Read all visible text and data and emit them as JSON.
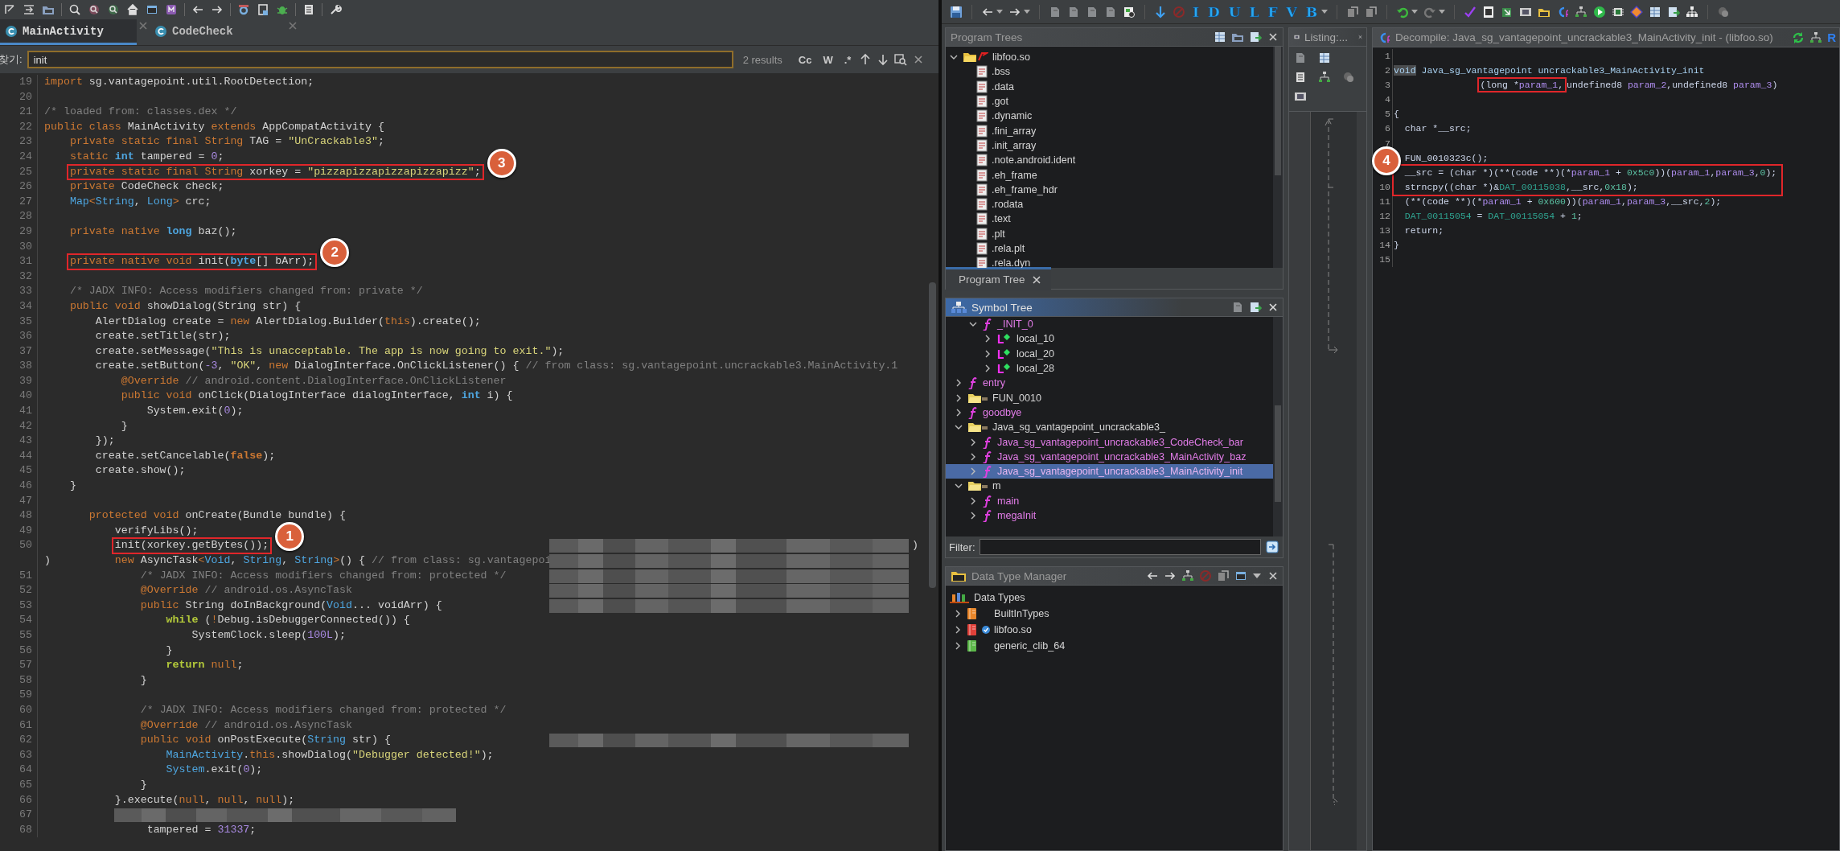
{
  "jadx": {
    "tabs": [
      {
        "label": "MainActivity",
        "selected": true
      },
      {
        "label": "CodeCheck",
        "selected": false
      }
    ],
    "search": {
      "label": "찾기:",
      "value": "init",
      "result_count": "2 results",
      "options": [
        "Cc",
        "W",
        ".*"
      ]
    },
    "code": [
      {
        "num": "19",
        "kind": "code",
        "segs": [
          {
            "kind": "kw",
            "text": "import"
          },
          {
            "kind": "pl",
            "text": " sg.vantagepoint.util.RootDetection;"
          }
        ]
      },
      {
        "num": "20",
        "kind": "blank"
      },
      {
        "num": "21",
        "kind": "code",
        "segs": [
          {
            "kind": "cm",
            "text": "/* loaded from: classes.dex */"
          }
        ]
      },
      {
        "num": "22",
        "kind": "code",
        "segs": [
          {
            "kind": "kw",
            "text": "public class"
          },
          {
            "kind": "pl",
            "text": " MainActivity "
          },
          {
            "kind": "kw",
            "text": "extends"
          },
          {
            "kind": "pl",
            "text": " AppCompatActivity {"
          }
        ]
      },
      {
        "num": "23",
        "kind": "code",
        "segs": [
          {
            "kind": "kw",
            "text": "    private static final String"
          },
          {
            "kind": "pl",
            "text": " TAG = "
          },
          {
            "kind": "str",
            "text": "\"UnCrackable3\""
          },
          {
            "kind": "pl",
            "text": ";"
          }
        ]
      },
      {
        "num": "24",
        "kind": "code",
        "segs": [
          {
            "kind": "kw",
            "text": "    static "
          },
          {
            "kind": "pt",
            "text": "int"
          },
          {
            "kind": "pl",
            "text": " tampered = "
          },
          {
            "kind": "num",
            "text": "0"
          },
          {
            "kind": "pl",
            "text": ";"
          }
        ]
      },
      {
        "num": "25",
        "kind": "boxed",
        "badge": "3",
        "segs": [
          {
            "kind": "kw",
            "text": "    private static final String"
          },
          {
            "kind": "pl",
            "text": " xorkey = "
          },
          {
            "kind": "str",
            "text": "\"pizzapizzapizzapizzapizz\""
          },
          {
            "kind": "pl",
            "text": ";"
          }
        ]
      },
      {
        "num": "26",
        "kind": "code",
        "segs": [
          {
            "kind": "kw",
            "text": "    private"
          },
          {
            "kind": "pl",
            "text": " CodeCheck check;"
          }
        ]
      },
      {
        "num": "27",
        "kind": "code",
        "segs": [
          {
            "kind": "ty",
            "text": "    Map"
          },
          {
            "kind": "kw",
            "text": "<"
          },
          {
            "kind": "ty",
            "text": "String"
          },
          {
            "kind": "pl",
            "text": ", "
          },
          {
            "kind": "ty",
            "text": "Long"
          },
          {
            "kind": "kw",
            "text": ">"
          },
          {
            "kind": "pl",
            "text": " crc;"
          }
        ]
      },
      {
        "num": "28",
        "kind": "blank"
      },
      {
        "num": "29",
        "kind": "code",
        "segs": [
          {
            "kind": "kw",
            "text": "    private native "
          },
          {
            "kind": "pt",
            "text": "long"
          },
          {
            "kind": "pl",
            "text": " baz();"
          }
        ]
      },
      {
        "num": "30",
        "kind": "blank"
      },
      {
        "num": "31",
        "kind": "boxed",
        "badge": "2",
        "segs": [
          {
            "kind": "kw",
            "text": "    private native void"
          },
          {
            "kind": "pl",
            "text": " init("
          },
          {
            "kind": "pt",
            "text": "byte"
          },
          {
            "kind": "pl",
            "text": "[] bArr);"
          }
        ]
      },
      {
        "num": "32",
        "kind": "blank"
      },
      {
        "num": "33",
        "kind": "code",
        "segs": [
          {
            "kind": "cm",
            "text": "    /* JADX INFO: Access modifiers changed from: private */"
          }
        ]
      },
      {
        "num": "34",
        "kind": "code",
        "segs": [
          {
            "kind": "kw",
            "text": "    public void"
          },
          {
            "kind": "pl",
            "text": " showDialog(String str) {"
          }
        ]
      },
      {
        "num": "35",
        "kind": "code",
        "segs": [
          {
            "kind": "pl",
            "text": "        AlertDialog create = "
          },
          {
            "kind": "kw",
            "text": "new"
          },
          {
            "kind": "pl",
            "text": " AlertDialog.Builder("
          },
          {
            "kind": "kw",
            "text": "this"
          },
          {
            "kind": "pl",
            "text": ").create();"
          }
        ]
      },
      {
        "num": "36",
        "kind": "code",
        "segs": [
          {
            "kind": "pl",
            "text": "        create.setTitle(str);"
          }
        ]
      },
      {
        "num": "37",
        "kind": "code",
        "segs": [
          {
            "kind": "pl",
            "text": "        create.setMessage("
          },
          {
            "kind": "str",
            "text": "\"This is unacceptable. The app is now going to exit.\""
          },
          {
            "kind": "pl",
            "text": ");"
          }
        ]
      },
      {
        "num": "38",
        "kind": "code",
        "segs": [
          {
            "kind": "pl",
            "text": "        create.setButton("
          },
          {
            "kind": "num",
            "text": "-3"
          },
          {
            "kind": "pl",
            "text": ", "
          },
          {
            "kind": "str",
            "text": "\"OK\""
          },
          {
            "kind": "pl",
            "text": ", "
          },
          {
            "kind": "kw",
            "text": "new"
          },
          {
            "kind": "pl",
            "text": " DialogInterface.OnClickListener() { "
          },
          {
            "kind": "cm",
            "text": "// from class: sg.vantagepoint.uncrackable3.MainActivity.1"
          }
        ]
      },
      {
        "num": "39",
        "kind": "code",
        "segs": [
          {
            "kind": "kw",
            "text": "            @Override"
          },
          {
            "kind": "cm",
            "text": " // android.content.DialogInterface.OnClickListener"
          }
        ]
      },
      {
        "num": "40",
        "kind": "code",
        "segs": [
          {
            "kind": "kw",
            "text": "            public void"
          },
          {
            "kind": "pl",
            "text": " onClick(DialogInterface dialogInterface, "
          },
          {
            "kind": "pt",
            "text": "int"
          },
          {
            "kind": "pl",
            "text": " i) {"
          }
        ]
      },
      {
        "num": "41",
        "kind": "code",
        "segs": [
          {
            "kind": "pl",
            "text": "                System.exit("
          },
          {
            "kind": "num",
            "text": "0"
          },
          {
            "kind": "pl",
            "text": ");"
          }
        ]
      },
      {
        "num": "42",
        "kind": "code",
        "segs": [
          {
            "kind": "pl",
            "text": "            }"
          }
        ]
      },
      {
        "num": "43",
        "kind": "code",
        "segs": [
          {
            "kind": "pl",
            "text": "        });"
          }
        ]
      },
      {
        "num": "44",
        "kind": "code",
        "segs": [
          {
            "kind": "pl",
            "text": "        create.setCancelable("
          },
          {
            "kind": "kb",
            "text": "false"
          },
          {
            "kind": "pl",
            "text": ");"
          }
        ]
      },
      {
        "num": "45",
        "kind": "code",
        "segs": [
          {
            "kind": "pl",
            "text": "        create.show();"
          }
        ]
      },
      {
        "num": "46",
        "kind": "code",
        "segs": [
          {
            "kind": "pl",
            "text": "    }"
          }
        ]
      },
      {
        "num": "47",
        "kind": "blank"
      },
      {
        "num": "48",
        "kind": "code",
        "segs": [
          {
            "kind": "kw",
            "text": "       protected void"
          },
          {
            "kind": "pl",
            "text": " onCreate(Bundle bundle) {"
          }
        ]
      },
      {
        "num": "49",
        "kind": "code",
        "segs": [
          {
            "kind": "pl",
            "text": "           verifyLibs();"
          }
        ]
      },
      {
        "num": "50",
        "kind": "boxed",
        "badge": "1",
        "redaction": {
          "kind": "right"
        },
        "tail": ")",
        "segs": [
          {
            "kind": "pl",
            "text": "           init(xorkey.getBytes());"
          }
        ]
      },
      {
        "kind": "code",
        "redaction": {
          "kind": "right"
        },
        "segs": [
          {
            "kind": "pl",
            "text": ")          "
          },
          {
            "kind": "kw",
            "text": "new"
          },
          {
            "kind": "pl",
            "text": " AsyncTask"
          },
          {
            "kind": "kw",
            "text": "<"
          },
          {
            "kind": "ty",
            "text": "Void"
          },
          {
            "kind": "pl",
            "text": ", "
          },
          {
            "kind": "ty",
            "text": "String"
          },
          {
            "kind": "pl",
            "text": ", "
          },
          {
            "kind": "ty",
            "text": "String"
          },
          {
            "kind": "kw",
            "text": ">"
          },
          {
            "kind": "pl",
            "text": "() { "
          },
          {
            "kind": "cm",
            "text": "// from class: sg.vantagepoi"
          }
        ]
      },
      {
        "num": "51",
        "kind": "code",
        "redaction": {
          "kind": "right"
        },
        "segs": [
          {
            "kind": "cm",
            "text": "               /* JADX INFO: Access modifiers changed from: protected */"
          }
        ]
      },
      {
        "num": "52",
        "kind": "code",
        "redaction": {
          "kind": "right"
        },
        "segs": [
          {
            "kind": "kw",
            "text": "               @Override"
          },
          {
            "kind": "cm",
            "text": " // android.os.AsyncTask"
          }
        ]
      },
      {
        "num": "53",
        "kind": "code",
        "redaction": {
          "kind": "right"
        },
        "segs": [
          {
            "kind": "kw",
            "text": "               public"
          },
          {
            "kind": "pl",
            "text": " String doInBackground("
          },
          {
            "kind": "ty",
            "text": "Void"
          },
          {
            "kind": "pl",
            "text": "... voidArr) {"
          }
        ]
      },
      {
        "num": "54",
        "kind": "code",
        "segs": [
          {
            "kind": "ctl",
            "text": "                   while"
          },
          {
            "kind": "pl",
            "text": " ("
          },
          {
            "kind": "kw",
            "text": "!"
          },
          {
            "kind": "pl",
            "text": "Debug.isDebuggerConnected()) {"
          }
        ]
      },
      {
        "num": "55",
        "kind": "code",
        "segs": [
          {
            "kind": "pl",
            "text": "                       SystemClock.sleep("
          },
          {
            "kind": "num",
            "text": "100L"
          },
          {
            "kind": "pl",
            "text": ");"
          }
        ]
      },
      {
        "num": "56",
        "kind": "code",
        "segs": [
          {
            "kind": "pl",
            "text": "                   }"
          }
        ]
      },
      {
        "num": "57",
        "kind": "code",
        "segs": [
          {
            "kind": "ctl",
            "text": "                   return "
          },
          {
            "kind": "kw",
            "text": "null"
          },
          {
            "kind": "pl",
            "text": ";"
          }
        ]
      },
      {
        "num": "58",
        "kind": "code",
        "segs": [
          {
            "kind": "pl",
            "text": "               }"
          }
        ]
      },
      {
        "num": "59",
        "kind": "blank"
      },
      {
        "num": "60",
        "kind": "code",
        "segs": [
          {
            "kind": "cm",
            "text": "               /* JADX INFO: Access modifiers changed from: protected */"
          }
        ]
      },
      {
        "num": "61",
        "kind": "code",
        "segs": [
          {
            "kind": "kw",
            "text": "               @Override"
          },
          {
            "kind": "cm",
            "text": " // android.os.AsyncTask"
          }
        ]
      },
      {
        "num": "62",
        "kind": "code",
        "redaction": {
          "kind": "right"
        },
        "segs": [
          {
            "kind": "kw",
            "text": "               public void"
          },
          {
            "kind": "pl",
            "text": " onPostExecute("
          },
          {
            "kind": "ty",
            "text": "String"
          },
          {
            "kind": "pl",
            "text": " str) {"
          }
        ]
      },
      {
        "num": "63",
        "kind": "code",
        "segs": [
          {
            "kind": "ty",
            "text": "                   MainActivity"
          },
          {
            "kind": "pl",
            "text": "."
          },
          {
            "kind": "kw",
            "text": "this"
          },
          {
            "kind": "pl",
            "text": ".showDialog("
          },
          {
            "kind": "str",
            "text": "\"Debugger detected!\""
          },
          {
            "kind": "pl",
            "text": ");"
          }
        ]
      },
      {
        "num": "64",
        "kind": "code",
        "segs": [
          {
            "kind": "ty",
            "text": "                   System"
          },
          {
            "kind": "pl",
            "text": ".exit("
          },
          {
            "kind": "num",
            "text": "0"
          },
          {
            "kind": "pl",
            "text": ");"
          }
        ]
      },
      {
        "num": "65",
        "kind": "code",
        "segs": [
          {
            "kind": "pl",
            "text": "               }"
          }
        ]
      },
      {
        "num": "66",
        "kind": "code",
        "segs": [
          {
            "kind": "pl",
            "text": "           }.execute("
          },
          {
            "kind": "kw",
            "text": "null"
          },
          {
            "kind": "pl",
            "text": ", "
          },
          {
            "kind": "kw",
            "text": "null"
          },
          {
            "kind": "pl",
            "text": ", "
          },
          {
            "kind": "kw",
            "text": "null"
          },
          {
            "kind": "pl",
            "text": ");"
          }
        ]
      },
      {
        "num": "67",
        "kind": "blank",
        "redaction": {
          "kind": "left"
        }
      },
      {
        "num": "68",
        "kind": "code",
        "segs": [
          {
            "kind": "pl",
            "text": "                tampered = "
          },
          {
            "kind": "num",
            "text": "31337"
          },
          {
            "kind": "pl",
            "text": ";"
          }
        ]
      }
    ]
  },
  "ghidra": {
    "toolbar_letters": [
      "I",
      "D",
      "U",
      "L",
      "F",
      "V",
      "B"
    ],
    "program_trees": {
      "title": "Program Trees",
      "tab": "Program Tree",
      "items": [
        {
          "label": "libfoo.so",
          "kind": "program",
          "expanded": true,
          "children": [
            {
              "label": ".bss",
              "kind": "section"
            },
            {
              "label": ".data",
              "kind": "section"
            },
            {
              "label": ".got",
              "kind": "section"
            },
            {
              "label": ".dynamic",
              "kind": "section"
            },
            {
              "label": ".fini_array",
              "kind": "section"
            },
            {
              "label": ".init_array",
              "kind": "section"
            },
            {
              "label": ".note.android.ident",
              "kind": "section"
            },
            {
              "label": ".eh_frame",
              "kind": "section"
            },
            {
              "label": ".eh_frame_hdr",
              "kind": "section"
            },
            {
              "label": ".rodata",
              "kind": "section"
            },
            {
              "label": ".text",
              "kind": "section"
            },
            {
              "label": ".plt",
              "kind": "section"
            },
            {
              "label": ".rela.plt",
              "kind": "section"
            },
            {
              "label": ".rela.dyn",
              "kind": "section"
            }
          ]
        }
      ]
    },
    "symbol_tree": {
      "title": "Symbol Tree",
      "filter_label": "Filter:",
      "items": [
        {
          "children": [
            {
              "label": "_INIT_0",
              "kind": "function",
              "expanded": true,
              "selected": false,
              "children": [
                {
                  "label": "local_10",
                  "kind": "local",
                  "expanded": false,
                  "selected": false
                },
                {
                  "label": "local_20",
                  "kind": "local",
                  "expanded": false,
                  "selected": false
                },
                {
                  "label": "local_28",
                  "kind": "local",
                  "expanded": false,
                  "selected": false
                }
              ]
            }
          ]
        },
        {
          "label": "entry",
          "kind": "function",
          "expanded": false,
          "selected": false
        },
        {
          "label": "FUN_0010",
          "kind": "folder",
          "expanded": false,
          "selected": false
        },
        {
          "label": "goodbye",
          "kind": "function",
          "expanded": false,
          "selected": false
        },
        {
          "label": "Java_sg_vantagepoint_uncrackable3_",
          "kind": "folder",
          "expanded": true,
          "selected": false,
          "children": [
            {
              "label": "Java_sg_vantagepoint_uncrackable3_CodeCheck_bar",
              "kind": "function",
              "expanded": false,
              "selected": false
            },
            {
              "label": "Java_sg_vantagepoint_uncrackable3_MainActivity_baz",
              "kind": "function",
              "expanded": false,
              "selected": false
            },
            {
              "label": "Java_sg_vantagepoint_uncrackable3_MainActivity_init",
              "kind": "function",
              "expanded": false,
              "selected": true
            }
          ]
        },
        {
          "label": "m",
          "kind": "folder",
          "expanded": true,
          "selected": false,
          "children": [
            {
              "label": "main",
              "kind": "function",
              "expanded": false,
              "selected": false
            },
            {
              "label": "megaInit",
              "kind": "function",
              "expanded": false,
              "selected": false
            }
          ]
        }
      ]
    },
    "data_types": {
      "title": "Data Type Manager",
      "root": "Data Types",
      "items": [
        {
          "label": "BuiltInTypes",
          "color": "#e8862a",
          "verified": false
        },
        {
          "label": "libfoo.so",
          "color": "#e0413a",
          "verified": true
        },
        {
          "label": "generic_clib_64",
          "color": "#5cb84a",
          "verified": false
        }
      ]
    },
    "listing": {
      "title": "Listing:..."
    },
    "decompiler": {
      "title": "Decompile: Java_sg_vantagepoint_uncrackable3_MainActivity_init -  (libfoo.so)",
      "title_tail": "R",
      "lines": [
        {
          "num": "1",
          "kind": "blank"
        },
        {
          "num": "2",
          "kind": "line",
          "segs": [
            {
              "kind": "vd",
              "text": "void"
            },
            {
              "kind": "fn",
              "text": " Java_sg_vantagepoint uncrackable3_MainActivity_init"
            }
          ]
        },
        {
          "num": "3",
          "kind": "line",
          "segs": [
            {
              "kind": "pl",
              "text": "               (long *",
              "boxed": true
            },
            {
              "kind": "pa",
              "text": "param_1",
              "boxed": true
            },
            {
              "kind": "pl",
              "text": ",",
              "boxed": true
            },
            {
              "kind": "pl",
              "text": "undefined8 ",
              "boxed": false
            },
            {
              "kind": "pa",
              "text": "param_2",
              "boxed": false
            },
            {
              "kind": "pl",
              "text": ",undefined8 ",
              "boxed": false
            },
            {
              "kind": "pa",
              "text": "param_3",
              "boxed": false
            },
            {
              "kind": "pl",
              "text": ")",
              "boxed": false
            }
          ]
        },
        {
          "num": "4",
          "kind": "blank"
        },
        {
          "num": "5",
          "kind": "line",
          "segs": [
            {
              "kind": "pl",
              "text": "{"
            }
          ]
        },
        {
          "num": "6",
          "kind": "line",
          "segs": [
            {
              "kind": "pl",
              "text": "  char *__src;"
            }
          ]
        },
        {
          "num": "7",
          "kind": "blank"
        },
        {
          "kind": "line",
          "segs": [
            {
              "kind": "pl",
              "text": "  FUN_0010323c();"
            }
          ]
        },
        {
          "kind": "box",
          "badge": "4",
          "lines": [
            {
              "kind": "line",
              "segs": [
                {
                  "kind": "pl",
                  "text": "  __src = (char *)(**(code **)(*"
                },
                {
                  "kind": "pa",
                  "text": "param_1"
                },
                {
                  "kind": "pl",
                  "text": " + "
                },
                {
                  "kind": "nm",
                  "text": "0x5c0"
                },
                {
                  "kind": "pl",
                  "text": "))("
                },
                {
                  "kind": "pa",
                  "text": "param_1"
                },
                {
                  "kind": "pl",
                  "text": ","
                },
                {
                  "kind": "pa",
                  "text": "param_3"
                },
                {
                  "kind": "pl",
                  "text": ","
                },
                {
                  "kind": "nm",
                  "text": "0"
                },
                {
                  "kind": "pl",
                  "text": ");"
                }
              ]
            },
            {
              "num": "10",
              "kind": "line",
              "segs": [
                {
                  "kind": "pl",
                  "text": "  strncpy((char *)&"
                },
                {
                  "kind": "dt",
                  "text": "DAT_00115038"
                },
                {
                  "kind": "pl",
                  "text": ",__src,"
                },
                {
                  "kind": "nm",
                  "text": "0x18"
                },
                {
                  "kind": "pl",
                  "text": ");"
                }
              ]
            }
          ]
        },
        {
          "num": "11",
          "kind": "line",
          "segs": [
            {
              "kind": "pl",
              "text": "  (**(code **)(*"
            },
            {
              "kind": "pa",
              "text": "param_1"
            },
            {
              "kind": "pl",
              "text": " + "
            },
            {
              "kind": "nm",
              "text": "0x600"
            },
            {
              "kind": "pl",
              "text": "))("
            },
            {
              "kind": "pa",
              "text": "param_1"
            },
            {
              "kind": "pl",
              "text": ","
            },
            {
              "kind": "pa",
              "text": "param_3"
            },
            {
              "kind": "pl",
              "text": ",__src,"
            },
            {
              "kind": "nm",
              "text": "2"
            },
            {
              "kind": "pl",
              "text": ");"
            }
          ]
        },
        {
          "num": "12",
          "kind": "line",
          "segs": [
            {
              "kind": "dt",
              "text": "  DAT_00115054"
            },
            {
              "kind": "pl",
              "text": " = "
            },
            {
              "kind": "dt",
              "text": "DAT_00115054"
            },
            {
              "kind": "pl",
              "text": " + "
            },
            {
              "kind": "nm",
              "text": "1"
            },
            {
              "kind": "pl",
              "text": ";"
            }
          ]
        },
        {
          "num": "13",
          "kind": "line",
          "segs": [
            {
              "kind": "pl",
              "text": "  return;"
            }
          ]
        },
        {
          "num": "14",
          "kind": "line",
          "segs": [
            {
              "kind": "pl",
              "text": "}"
            }
          ]
        },
        {
          "num": "15",
          "kind": "blank"
        }
      ]
    }
  }
}
